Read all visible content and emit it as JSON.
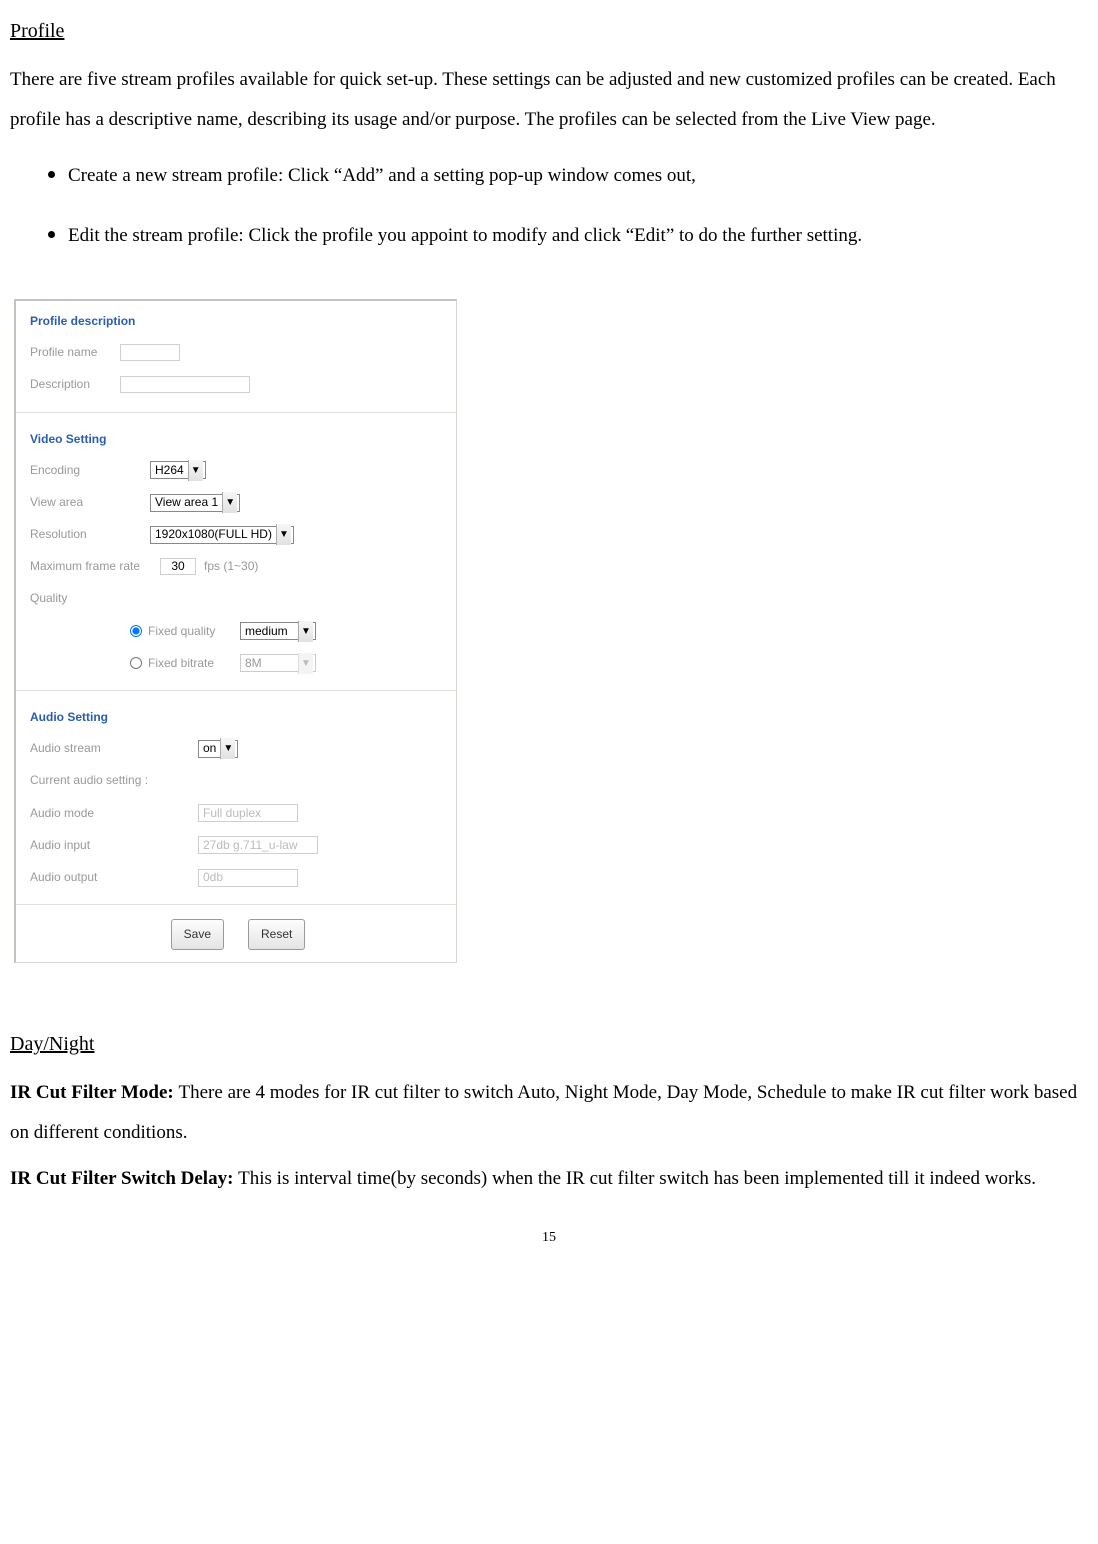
{
  "section1": {
    "heading": "Profile",
    "para": "There are five stream profiles available for quick set-up. These settings can be adjusted and new customized profiles can be created. Each profile has a descriptive name, describing its usage and/or purpose. The profiles can be selected from the Live View page.",
    "bullet1": "Create a new stream profile: Click “Add” and a setting pop-up window comes out,",
    "bullet2": "Edit the stream profile: Click the profile you appoint to modify and click “Edit” to do the further setting."
  },
  "figure": {
    "profile_desc": {
      "title": "Profile description",
      "name_label": "Profile name",
      "name_value": "",
      "desc_label": "Description",
      "desc_value": ""
    },
    "video": {
      "title": "Video Setting",
      "encoding_label": "Encoding",
      "encoding_value": "H264",
      "viewarea_label": "View area",
      "viewarea_value": "View area 1",
      "resolution_label": "Resolution",
      "resolution_value": "1920x1080(FULL HD)",
      "framerate_label": "Maximum frame rate",
      "framerate_value": "30",
      "framerate_suffix": "fps (1~30)",
      "quality_label": "Quality",
      "fixed_quality_label": "Fixed quality",
      "fixed_quality_value": "medium",
      "fixed_bitrate_label": "Fixed bitrate",
      "fixed_bitrate_value": "8M"
    },
    "audio": {
      "title": "Audio Setting",
      "stream_label": "Audio stream",
      "stream_value": "on",
      "current_label": "Current audio setting :",
      "mode_label": "Audio mode",
      "mode_value": "Full duplex",
      "input_label": "Audio input",
      "input_value": "27db g.711_u-law",
      "output_label": "Audio output",
      "output_value": "0db"
    },
    "buttons": {
      "save": "Save",
      "reset": "Reset"
    }
  },
  "section2": {
    "heading": "Day/Night",
    "mode_label": "IR Cut Filter Mode: ",
    "mode_text": "There are 4 modes for IR cut filter to switch Auto, Night Mode, Day Mode, Schedule to make IR cut filter work based on different conditions.",
    "delay_label": "IR Cut Filter Switch Delay: ",
    "delay_text": "This is interval time(by seconds) when the IR cut filter switch has been implemented till it indeed works."
  },
  "page_number": "15"
}
